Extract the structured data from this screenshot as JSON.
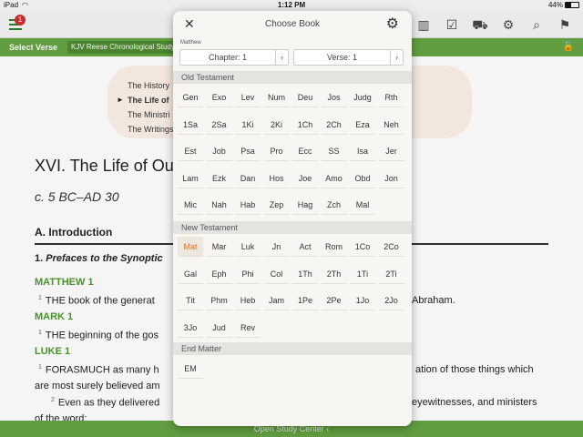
{
  "status_bar": {
    "device": "iPad",
    "time": "1:12 PM",
    "battery_text": "44%",
    "battery_level": 0.44
  },
  "toolbar": {
    "badge_count": "1",
    "icons": [
      "library-icon",
      "checklist-icon",
      "cart-icon",
      "gear-icon",
      "search-icon",
      "bookmark-icon"
    ]
  },
  "greenbar": {
    "select_verse": "Select Verse",
    "resource": "KJV Reese Chronological Study"
  },
  "document": {
    "toc": [
      {
        "text": "The History",
        "current": false
      },
      {
        "text": "The Life of",
        "current": true
      },
      {
        "text": "The Ministri",
        "current": false
      },
      {
        "text": "The Writings",
        "current": false
      }
    ],
    "heading": "XVI. The Life of Ou",
    "date": "c. 5 BC–AD 30",
    "section": "A. Introduction",
    "subsection_num": "1.",
    "subsection": "Prefaces to the Synoptic",
    "books": [
      {
        "name": "MATTHEW 1",
        "verse_num": "1",
        "verse": "THE book of the generat",
        "verse_tail": "Abraham."
      },
      {
        "name": "MARK 1",
        "verse_num": "1",
        "verse": "THE beginning of the gos",
        "verse_tail": ""
      },
      {
        "name": "LUKE 1",
        "verse_num": "1",
        "verse": "FORASMUCH as many h",
        "verse_tail": "ation of those things which"
      }
    ],
    "luke_line2": "are most surely believed am",
    "luke_v2_num": "2",
    "luke_v2": "Even as they delivered",
    "luke_v2_tail": "eyewitnesses, and ministers",
    "luke_line3": "of the word;"
  },
  "bottom_bar": {
    "label": "Open Study Center"
  },
  "modal": {
    "title": "Choose Book",
    "context": "Matthew",
    "chapter_label": "Chapter: 1",
    "verse_label": "Verse: 1",
    "old_testament_label": "Old Testament",
    "new_testament_label": "New Testament",
    "end_matter_label": "End Matter",
    "selected_book": "Mat",
    "old_testament": [
      "Gen",
      "Exo",
      "Lev",
      "Num",
      "Deu",
      "Jos",
      "Judg",
      "Rth",
      "1Sa",
      "2Sa",
      "1Ki",
      "2Ki",
      "1Ch",
      "2Ch",
      "Eza",
      "Neh",
      "Est",
      "Job",
      "Psa",
      "Pro",
      "Ecc",
      "SS",
      "Isa",
      "Jer",
      "Lam",
      "Ezk",
      "Dan",
      "Hos",
      "Joe",
      "Amo",
      "Obd",
      "Jon",
      "Mic",
      "Nah",
      "Hab",
      "Zep",
      "Hag",
      "Zch",
      "Mal"
    ],
    "new_testament": [
      "Mat",
      "Mar",
      "Luk",
      "Jn",
      "Act",
      "Rom",
      "1Co",
      "2Co",
      "Gal",
      "Eph",
      "Phi",
      "Col",
      "1Th",
      "2Th",
      "1Ti",
      "2Ti",
      "Tit",
      "Phm",
      "Heb",
      "Jam",
      "1Pe",
      "2Pe",
      "1Jo",
      "2Jo",
      "3Jo",
      "Jud",
      "Rev"
    ],
    "end_matter": [
      "EM"
    ]
  }
}
